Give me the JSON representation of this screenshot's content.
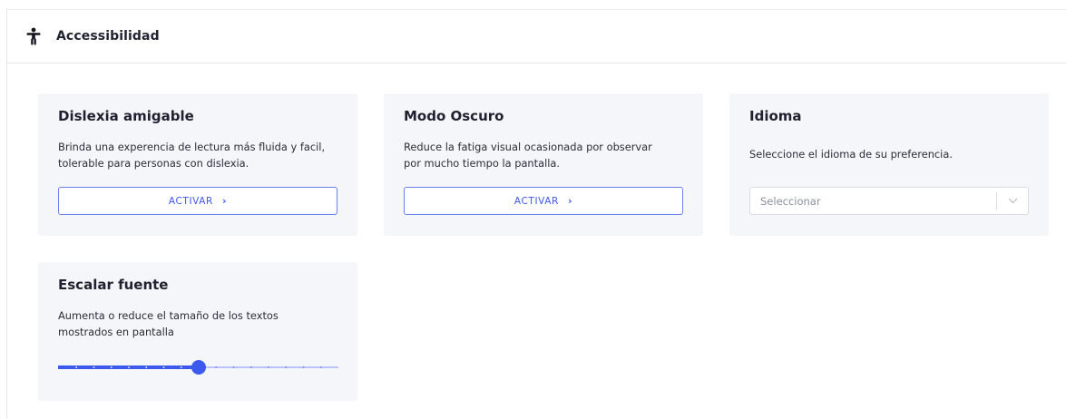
{
  "header": {
    "title": "Accessibilidad",
    "icon": "accessibility-icon"
  },
  "colors": {
    "accent": "#3c59ee",
    "card_bg": "#f5f6f9",
    "border": "#e3e5ea"
  },
  "cards": {
    "dyslexia": {
      "title": "Dislexia amigable",
      "line1": "Brinda una experencia de lectura más fluida y facil,",
      "line2": "tolerable para personas con dislexia.",
      "button_label": "ACTIVAR"
    },
    "dark_mode": {
      "title": "Modo Oscuro",
      "line1": "Reduce la fatiga visual ocasionada por observar",
      "line2": "por mucho tiempo la pantalla.",
      "button_label": "ACTIVAR"
    },
    "language": {
      "title": "Idioma",
      "description": "Seleccione el idioma de su preferencia.",
      "select_placeholder": "Seleccionar"
    },
    "font_scale": {
      "title": "Escalar fuente",
      "line1": "Aumenta o reduce el tamaño de los textos",
      "line2": "mostrados en pantalla",
      "slider_value": 0.5,
      "slider_steps": 16
    }
  }
}
